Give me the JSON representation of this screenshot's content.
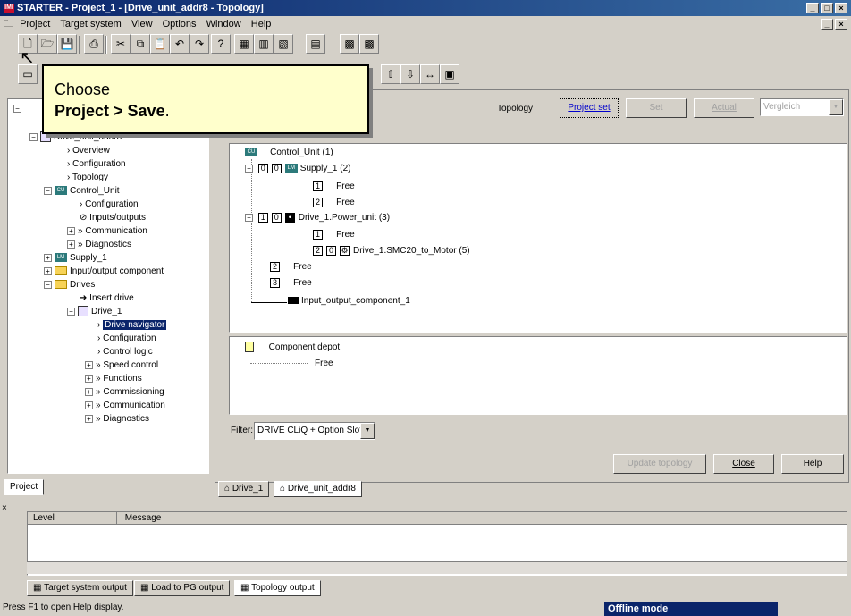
{
  "window": {
    "title": "STARTER - Project_1 - [Drive_unit_addr8 - Topology]",
    "app_icon_text": "IMI"
  },
  "menu": [
    "Project",
    "Target system",
    "View",
    "Options",
    "Window",
    "Help"
  ],
  "callout": {
    "line1": "Choose",
    "line2": "Project > Save",
    "line2_suffix": "."
  },
  "tree": {
    "items": [
      {
        "label": "Drive_unit_addr8"
      },
      {
        "label": "Overview"
      },
      {
        "label": "Configuration"
      },
      {
        "label": "Topology"
      },
      {
        "label": "Control_Unit"
      },
      {
        "label": "Configuration"
      },
      {
        "label": "Inputs/outputs"
      },
      {
        "label": "Communication"
      },
      {
        "label": "Diagnostics"
      },
      {
        "label": "Supply_1"
      },
      {
        "label": "Input/output component"
      },
      {
        "label": "Drives"
      },
      {
        "label": "Insert drive"
      },
      {
        "label": "Drive_1"
      },
      {
        "label": "Drive navigator"
      },
      {
        "label": "Configuration"
      },
      {
        "label": "Control logic"
      },
      {
        "label": "Speed control"
      },
      {
        "label": "Functions"
      },
      {
        "label": "Commissioning"
      },
      {
        "label": "Communication"
      },
      {
        "label": "Diagnostics"
      }
    ],
    "tab_label": "Project"
  },
  "topology": {
    "label": "Topology",
    "buttons": {
      "project_set": "Project set",
      "set": "Set",
      "actual": "Actual",
      "vergleich": "Vergleich"
    },
    "rows": [
      {
        "text": "Control_Unit (1)"
      },
      {
        "text": "Supply_1 (2)"
      },
      {
        "text": "Free"
      },
      {
        "text": "Free"
      },
      {
        "text": "Drive_1.Power_unit (3)"
      },
      {
        "text": "Free"
      },
      {
        "text": "Drive_1.SMC20_to_Motor (5)"
      },
      {
        "text": "Free"
      },
      {
        "text": "Free"
      },
      {
        "text": "Input_output_component_1"
      }
    ],
    "depot_label": "Component depot",
    "depot_free": "Free",
    "filter_label": "Filter:",
    "filter_value": "DRIVE CLiQ + Option Slot",
    "update_button": "Update topology",
    "close_button": "Close",
    "help_button": "Help",
    "doc_tabs": [
      "Drive_1",
      "Drive_unit_addr8"
    ]
  },
  "output": {
    "columns": [
      "Level",
      "Message"
    ],
    "tabs": [
      "Target system output",
      "Load to PG output",
      "Topology output"
    ]
  },
  "status": {
    "text": "Press F1 to open Help display.",
    "mode": "Offline mode"
  }
}
